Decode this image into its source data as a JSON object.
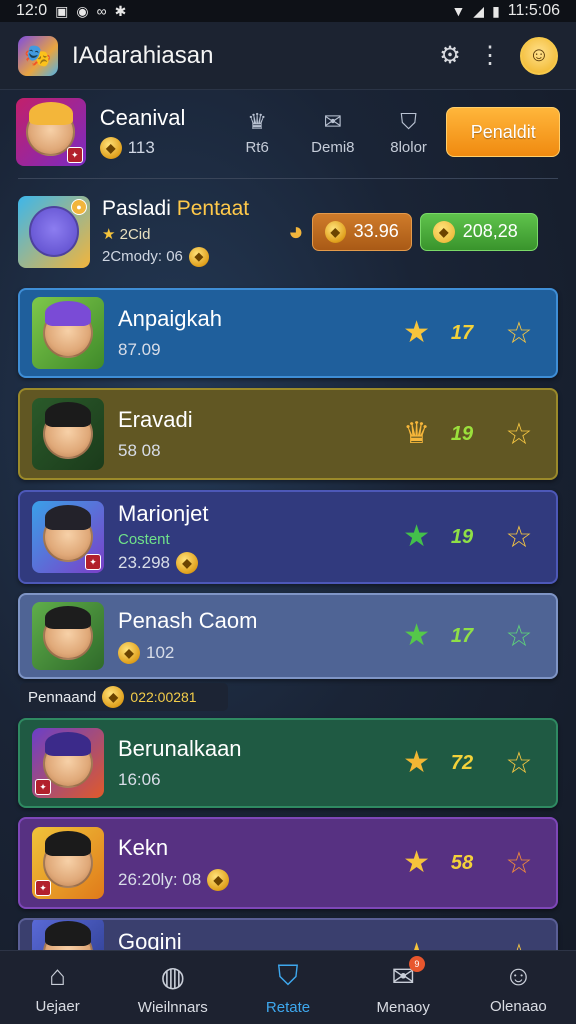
{
  "status_bar": {
    "time_left": "12:0",
    "time_right": "11:5:06"
  },
  "app": {
    "title": "IAdarahiasan"
  },
  "profile": {
    "name": "Ceanival",
    "coins": "113",
    "promo_label": "Penaldit",
    "stats": [
      {
        "label": "Rt6",
        "icon": "crown-icon"
      },
      {
        "label": "Demi8",
        "icon": "scroll-icon"
      },
      {
        "label": "8lolor",
        "icon": "shield-icon"
      }
    ]
  },
  "featured": {
    "name_a": "Pasladi",
    "name_b": "Pentaat",
    "rank": "2Cid",
    "sub": "2Cmody: 06",
    "pill_orange": "33.96",
    "pill_green": "208,28"
  },
  "rows": [
    {
      "title": "Anpaigkah",
      "sub": "87.09",
      "score": "17",
      "score_color": "#f3d13a",
      "star_color": "#f6c43c",
      "bg": "#1f5f9c",
      "border": "#3f8ed6"
    },
    {
      "title": "Eravadi",
      "sub": "58 08",
      "score": "19",
      "score_color": "#9be03c",
      "star_color": "#f6b63a",
      "bg": "#615723",
      "border": "#9b8a2a"
    },
    {
      "title": "Marionjet",
      "status": "Costent",
      "sub": "23.298",
      "score": "19",
      "score_color": "#8fe046",
      "star_color": "#43c04b",
      "bg": "#313a7e",
      "border": "#4d58b8"
    },
    {
      "title": "Penash Caom",
      "sub": "102",
      "score": "17",
      "score_color": "#8fe046",
      "star_color": "#55c84a",
      "bg": "#4f6495",
      "border": "#7f95c6"
    },
    {
      "title": "Berunalkaan",
      "sub": "16:06",
      "score": "72",
      "score_color": "#f3d13a",
      "star_color": "#f2b634",
      "bg": "#1f5a43",
      "border": "#2f8a62"
    },
    {
      "title": "Kekn",
      "sub": "26:20ly: 08",
      "score": "58",
      "score_color": "#f3d13a",
      "star_color": "#f6c43c",
      "bg": "#573182",
      "border": "#7e47b8"
    },
    {
      "title": "Goqini",
      "sub": "",
      "score": "",
      "score_color": "#f3d13a",
      "star_color": "#f6c43c",
      "bg": "#3a3f6e",
      "border": "#5a5f96"
    }
  ],
  "banner": {
    "label": "Pennaand",
    "amount": "022:00281"
  },
  "nav": [
    {
      "label": "Uejaer",
      "icon": "home-icon"
    },
    {
      "label": "Wieilnnars",
      "icon": "chat-icon"
    },
    {
      "label": "Retate",
      "icon": "shield-download-icon",
      "active": true
    },
    {
      "label": "Menaoy",
      "icon": "message-icon",
      "badge": "9"
    },
    {
      "label": "Olenaao",
      "icon": "profile-icon"
    }
  ]
}
